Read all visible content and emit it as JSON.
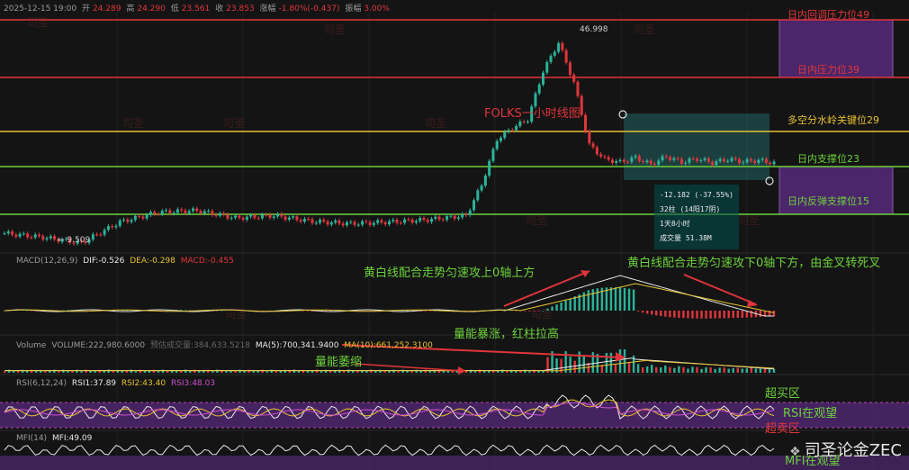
{
  "header": {
    "date": "2025-12-15 19:00",
    "open_label": "开",
    "open": "24.289",
    "high_label": "高",
    "high": "24.290",
    "low_label": "低",
    "low": "23.561",
    "close_label": "收",
    "close": "23.853",
    "change_label": "涨幅",
    "change": "-1.80%(-0.437)",
    "amp_label": "振幅",
    "amp": "3.00%"
  },
  "levels": {
    "l49": "日内回调压力位49",
    "l39": "日内压力位39",
    "l29": "多空分水岭关键位29",
    "l23": "日内支撑位23",
    "l15": "日内反弹支撑位15"
  },
  "price_marks": {
    "high": "46.998",
    "low": "← 9.509"
  },
  "chart_title": "FOLKS一小时线图",
  "tooltip": {
    "line1": "-12.182 (-37.55%)",
    "line2": "32柱 (14阳17阴)",
    "line3": "1天8小时",
    "line4": "成交量 51.38M"
  },
  "macd": {
    "name": "MACD(12,26,9)",
    "dif": "DIF:-0.526",
    "dea": "DEA:-0.298",
    "macd": "MACD:-0.455"
  },
  "volume": {
    "name": "Volume",
    "vol": "VOLUME:222,980.6000",
    "est": "预估成交量:384,633.5218",
    "ma5": "MA(5):700,341.9400",
    "ma10": "MA(10):661,252.3100"
  },
  "rsi": {
    "name": "RSI(6,12,24)",
    "r1": "RSI1:37.89",
    "r2": "RSI2:43.40",
    "r3": "RSI3:48.03"
  },
  "mfi": {
    "name": "MFI(14)",
    "v": "MFI:49.09"
  },
  "annotations": {
    "macd_up": "黄白线配合走势匀速攻上0轴上方",
    "macd_down": "黄白线配合走势匀速攻下0轴下方，由金叉转死叉",
    "vol_surge": "量能暴涨，红柱拉高",
    "vol_shrink": "量能萎缩",
    "overbought": "超买区",
    "rsi_watch": "RSI在观望",
    "oversold": "超卖区",
    "mfi_watch": "MFI在观望"
  },
  "watermark": "司圣",
  "brand": "司圣论金ZEC",
  "colors": {
    "up": "#2bb39a",
    "down": "#e0353b",
    "dif": "#e8e8e8",
    "dea": "#e6c233",
    "purple": "#5a2a80"
  },
  "chart_data": {
    "type": "line",
    "title": "FOLKS一小时线图",
    "x": [
      0,
      5,
      10,
      15,
      20,
      25,
      30,
      35,
      40,
      45,
      50,
      55,
      60,
      62,
      64,
      66,
      68,
      70,
      72,
      74,
      76,
      78,
      80,
      82,
      84,
      86,
      88,
      90,
      92,
      94,
      96,
      98,
      100
    ],
    "series": [
      {
        "values": [
          11.5,
          10.8,
          9.8,
          13.5,
          15.2,
          15.5,
          14.2,
          14.6,
          13.6,
          13.2,
          13.5,
          13.9,
          14.6,
          20,
          28,
          30,
          31.5,
          40,
          45,
          38,
          27,
          24.5,
          24,
          24.8,
          23.6,
          25,
          24,
          24.6,
          23.9,
          24.5,
          24.1,
          24.3,
          23.85
        ]
      }
    ],
    "levels": [
      49,
      39,
      29,
      23,
      15
    ],
    "high": 46.998,
    "low": 9.509
  }
}
